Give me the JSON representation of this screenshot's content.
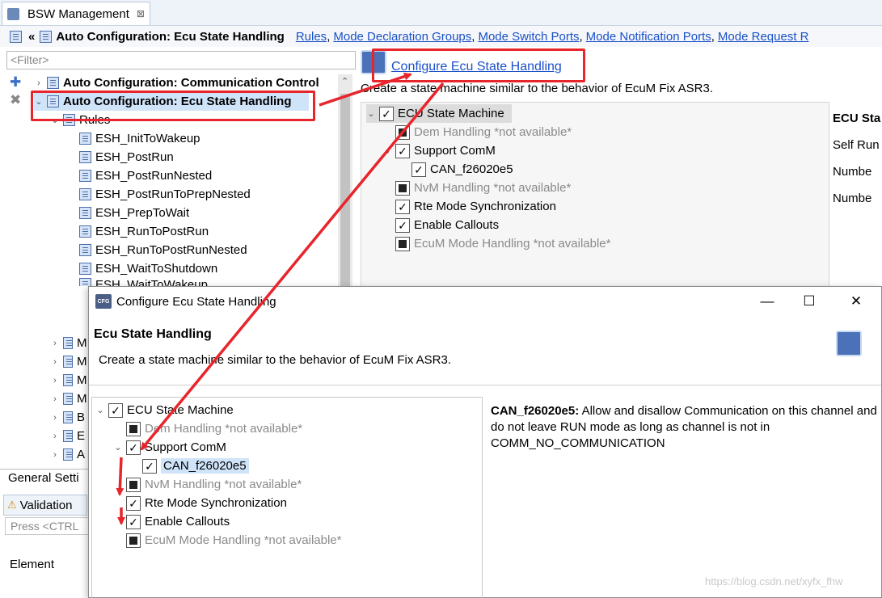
{
  "editor_tab": {
    "title": "BSW Management",
    "close": "⊠"
  },
  "breadcrumb": {
    "current": "Auto Configuration: Ecu State Handling",
    "links": [
      "Rules",
      "Mode Declaration Groups",
      "Mode Switch Ports",
      "Mode Notification Ports",
      "Mode Request R"
    ]
  },
  "left": {
    "filter_placeholder": "<Filter>",
    "tree": {
      "comm_control": "Auto Configuration: Communication Control",
      "esh": "Auto Configuration: Ecu State Handling",
      "rules": "Rules",
      "items": [
        "ESH_InitToWakeup",
        "ESH_PostRun",
        "ESH_PostRunNested",
        "ESH_PostRunToPrepNested",
        "ESH_PrepToWait",
        "ESH_RunToPostRun",
        "ESH_RunToPostRunNested",
        "ESH_WaitToShutdown",
        "ESH_WaitToWakeup"
      ],
      "collapsed": [
        "M",
        "M",
        "M",
        "M",
        "B",
        "E",
        "A"
      ]
    },
    "general_tab": "General Setti",
    "validation_tab": "Validation",
    "press_placeholder": "Press <CTRL",
    "element_label": "Element"
  },
  "right": {
    "configure_link": "Configure Ecu State Handling",
    "description": "Create a state machine similar to the behavior of EcuM Fix ASR3.",
    "tree": {
      "root": "ECU State Machine",
      "dem": "Dem Handling *not available*",
      "comm": "Support ComM",
      "can": "CAN_f26020e5",
      "nvm": "NvM Handling *not available*",
      "rte": "Rte Mode Synchronization",
      "callouts": "Enable Callouts",
      "ecum": "EcuM Mode Handling *not available*"
    },
    "side_labels": [
      "ECU Sta",
      "Self Run",
      "Numbe",
      "Numbe"
    ]
  },
  "dialog": {
    "title": "Configure Ecu State Handling",
    "icon_text": "CFG",
    "minimize": "—",
    "maximize": "☐",
    "close": "✕",
    "header": "Ecu State Handling",
    "subtitle": "Create a state machine similar to the behavior of EcuM Fix ASR3.",
    "tree": {
      "root": "ECU State Machine",
      "dem": "Dem Handling *not available*",
      "comm": "Support ComM",
      "can": "CAN_f26020e5",
      "nvm": "NvM Handling *not available*",
      "rte": "Rte Mode Synchronization",
      "callouts": "Enable Callouts",
      "ecum": "EcuM Mode Handling *not available*"
    },
    "detail_label": "CAN_f26020e5:",
    "detail_text": "Allow and disallow Communication on this channel and do not leave RUN mode as long as channel is not in COMM_NO_COMMUNICATION"
  },
  "watermark": "https://blog.csdn.net/xyfx_fhw",
  "colors": {
    "link": "#1a50c8",
    "highlight": "#e8252b",
    "selection": "#cfe3f9"
  }
}
